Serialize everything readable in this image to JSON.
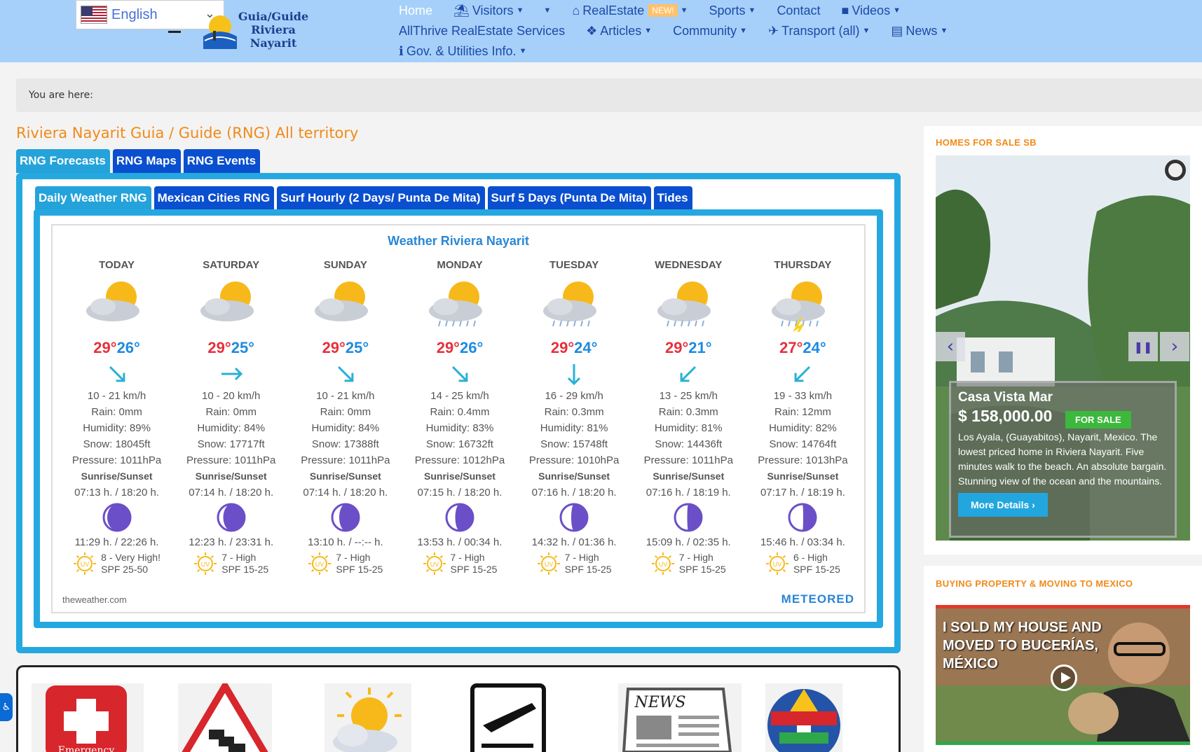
{
  "language": {
    "label": "English"
  },
  "logo": {
    "line1": "Guia/Guide",
    "line2": "Riviera",
    "line3": "Nayarit"
  },
  "nav": {
    "home": "Home",
    "visitors": "Visitors",
    "realestate": "RealEstate",
    "new_badge": "NEW!",
    "sports": "Sports",
    "contact": "Contact",
    "videos": "Videos",
    "allthrive": "AllThrive RealEstate Services",
    "articles": "Articles",
    "community": "Community",
    "transport": "Transport (all)",
    "news": "News",
    "gov": "Gov. & Utilities Info."
  },
  "breadcrumb": "You are here:",
  "page_title": "Riviera Nayarit Guia / Guide (RNG) All territory",
  "main_tabs": [
    "RNG Forecasts",
    "RNG Maps",
    "RNG Events"
  ],
  "sub_tabs": [
    "Daily Weather RNG",
    "Mexican Cities RNG",
    "Surf Hourly (2 Days/ Punta De Mita)",
    "Surf 5 Days (Punta De Mita)",
    "Tides"
  ],
  "weather": {
    "title": "Weather Riviera Nayarit",
    "source": "theweather.com",
    "brand": "METEORED",
    "sunrise_label": "Sunrise/Sunset",
    "days": [
      {
        "name": "TODAY",
        "icon": "partly-cloudy",
        "max": "29°",
        "min": "26°",
        "dir": "nw",
        "wind": "10 - 21 km/h",
        "rain": "Rain: 0mm",
        "humidity": "Humidity: 89%",
        "snow": "Snow: 18045ft",
        "pressure": "Pressure: 1011hPa",
        "sun": "07:13 h. / 18:20 h.",
        "moon": "11:29 h. / 22:26 h.",
        "uv": "8 - Very High!",
        "spf": "SPF 25-50"
      },
      {
        "name": "SATURDAY",
        "icon": "partly-cloudy",
        "max": "29°",
        "min": "25°",
        "dir": "w",
        "wind": "10 - 20 km/h",
        "rain": "Rain: 0mm",
        "humidity": "Humidity: 84%",
        "snow": "Snow: 17717ft",
        "pressure": "Pressure: 1011hPa",
        "sun": "07:14 h. / 18:20 h.",
        "moon": "12:23 h. / 23:31 h.",
        "uv": "7 - High",
        "spf": "SPF 15-25"
      },
      {
        "name": "SUNDAY",
        "icon": "partly-cloudy",
        "max": "29°",
        "min": "25°",
        "dir": "nw",
        "wind": "10 - 21 km/h",
        "rain": "Rain: 0mm",
        "humidity": "Humidity: 84%",
        "snow": "Snow: 17388ft",
        "pressure": "Pressure: 1011hPa",
        "sun": "07:14 h. / 18:20 h.",
        "moon": "13:10 h. / --:-- h.",
        "uv": "7 - High",
        "spf": "SPF 15-25"
      },
      {
        "name": "MONDAY",
        "icon": "rain",
        "max": "29°",
        "min": "26°",
        "dir": "nw",
        "wind": "14 - 25 km/h",
        "rain": "Rain: 0.4mm",
        "humidity": "Humidity: 83%",
        "snow": "Snow: 16732ft",
        "pressure": "Pressure: 1012hPa",
        "sun": "07:15 h. / 18:20 h.",
        "moon": "13:53 h. / 00:34 h.",
        "uv": "7 - High",
        "spf": "SPF 15-25"
      },
      {
        "name": "TUESDAY",
        "icon": "rain",
        "max": "29°",
        "min": "24°",
        "dir": "n",
        "wind": "16 - 29 km/h",
        "rain": "Rain: 0.3mm",
        "humidity": "Humidity: 81%",
        "snow": "Snow: 15748ft",
        "pressure": "Pressure: 1010hPa",
        "sun": "07:16 h. / 18:20 h.",
        "moon": "14:32 h. / 01:36 h.",
        "uv": "7 - High",
        "spf": "SPF 15-25"
      },
      {
        "name": "WEDNESDAY",
        "icon": "rain",
        "max": "29°",
        "min": "21°",
        "dir": "ne",
        "wind": "13 - 25 km/h",
        "rain": "Rain: 0.3mm",
        "humidity": "Humidity: 81%",
        "snow": "Snow: 14436ft",
        "pressure": "Pressure: 1011hPa",
        "sun": "07:16 h. / 18:19 h.",
        "moon": "15:09 h. / 02:35 h.",
        "uv": "7 - High",
        "spf": "SPF 15-25"
      },
      {
        "name": "THURSDAY",
        "icon": "storm",
        "max": "27°",
        "min": "24°",
        "dir": "ne",
        "wind": "19 - 33 km/h",
        "rain": "Rain: 12mm",
        "humidity": "Humidity: 82%",
        "snow": "Snow: 14764ft",
        "pressure": "Pressure: 1013hPa",
        "sun": "07:17 h. / 18:19 h.",
        "moon": "15:46 h. / 03:34 h.",
        "uv": "6 - High",
        "spf": "SPF 15-25"
      }
    ]
  },
  "bottom_icons": [
    {
      "name": "emergency-icon",
      "label": "Emergency"
    },
    {
      "name": "traffic-warning-icon"
    },
    {
      "name": "weather-sun-cloud-icon"
    },
    {
      "name": "airport-departure-icon"
    },
    {
      "name": "news-icon",
      "label": "NEWS"
    },
    {
      "name": "world-flags-icon"
    }
  ],
  "sidebar": {
    "homes_title": "HOMES FOR SALE SB",
    "listing": {
      "title": "Casa Vista Mar",
      "price": "$ 158,000.00",
      "badge": "FOR SALE",
      "desc": "Los Ayala, (Guayabitos), Nayarit, Mexico. The lowest priced home in Riviera Nayarit. Five minutes walk to the beach. An absolute bargain. Stunning view of the ocean and the mountains.",
      "button": "More Details"
    },
    "buying_title": "BUYING PROPERTY & MOVING TO MEXICO",
    "video_text": "I SOLD MY HOUSE AND MOVED TO BUCERÍAS, MÉXICO"
  },
  "colors": {
    "header": "#a6d0fa",
    "accent": "#f18a18",
    "tab": "#0a4fcf",
    "tab_active": "#24a3da",
    "frame": "#25a8e0"
  }
}
